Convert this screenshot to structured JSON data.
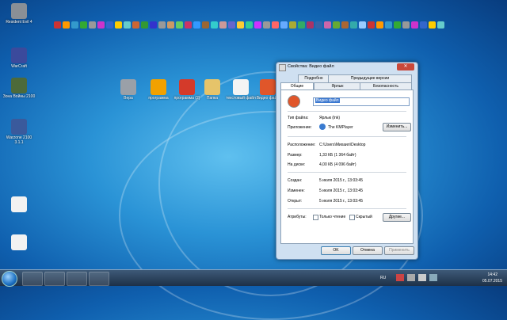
{
  "desktop_left": [
    {
      "label": "Resident Evil 4",
      "color": "#8a8f96"
    },
    {
      "label": "WarCraft",
      "color": "#3b4a9c"
    },
    {
      "label": "Зона Войны 2100",
      "color": "#4d6a3a"
    },
    {
      "label": "Warzone 2100 3.1.1",
      "color": "#3a5a9c"
    },
    {
      "label": "​",
      "color": "#f2f2f2"
    },
    {
      "label": "​",
      "color": "#f2f2f2"
    }
  ],
  "desktop_mid": [
    {
      "label": "Вера",
      "color": "#9aa0a8"
    },
    {
      "label": "программа",
      "color": "#f2a100"
    },
    {
      "label": "программа (2)",
      "color": "#d43a2a"
    },
    {
      "label": "Папка",
      "color": "#e6c46a"
    },
    {
      "label": "текстовый файл",
      "color": "#f4f4f4"
    },
    {
      "label": "Видео файл",
      "color": "#e0562a"
    }
  ],
  "dialog": {
    "title": "Свойства: Видео файл",
    "close": "✕",
    "tabs_top": [
      "Подробно",
      "Предыдущие версии"
    ],
    "tabs_bottom": [
      "Общие",
      "Ярлык",
      "Безопасность"
    ],
    "filename": "Видео файл",
    "file_type_label": "Тип файла:",
    "file_type_value": "Ярлык (lnk)",
    "app_label": "Приложение:",
    "app_value": "The KMPlayer",
    "change_button": "Изменить...",
    "location_label": "Расположение:",
    "location_value": "C:\\Users\\Михаил\\Desktop",
    "size_label": "Размер:",
    "size_value": "1,33 КБ (1 364 байт)",
    "disk_label": "На диске:",
    "disk_value": "4,00 КБ (4 096 байт)",
    "created_label": "Создан:",
    "created_value": "5 июля 2015 г., 13:03:45",
    "modified_label": "Изменен:",
    "modified_value": "5 июля 2015 г., 13:03:45",
    "opened_label": "Открыт:",
    "opened_value": "5 июля 2015 г., 13:03:45",
    "attributes_label": "Атрибуты:",
    "readonly_label": "Только чтение",
    "hidden_label": "Скрытый",
    "other_button": "Другие...",
    "ok": "OK",
    "cancel": "Отмена",
    "apply": "Применить"
  },
  "tray": {
    "lang": "RU",
    "time": "14:42",
    "date": "05.07.2015"
  }
}
